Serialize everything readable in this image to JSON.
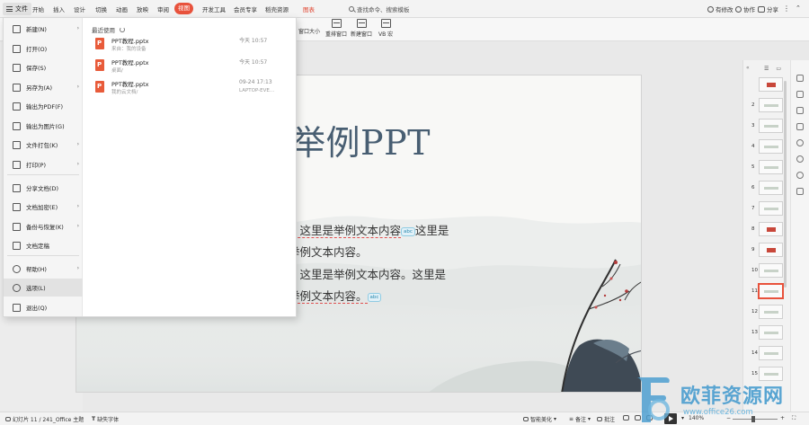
{
  "menubar": {
    "file_label": "文件",
    "tabs": [
      "开始",
      "插入",
      "设计",
      "切换",
      "动画",
      "放映",
      "审阅",
      "视图",
      "开发工具",
      "会员专享",
      "稻壳资源",
      "图表"
    ],
    "active_tab": "视图",
    "search_placeholder": "查找命令、搜索模板",
    "unsaved_label": "有修改",
    "collab_label": "协作",
    "share_label": "分享"
  },
  "ribbon": {
    "items": [
      {
        "label": "重排窗口",
        "icon": "arrange-window-icon"
      },
      {
        "label": "新建窗口",
        "icon": "new-window-icon"
      },
      {
        "label": "VB 宏",
        "icon": "vba-macro-icon"
      }
    ],
    "partial_label": "窗口大小"
  },
  "file_menu": {
    "items": [
      {
        "label": "新建(N)",
        "icon": "new-file-icon",
        "arrow": true
      },
      {
        "label": "打开(O)",
        "icon": "open-folder-icon",
        "arrow": false
      },
      {
        "label": "保存(S)",
        "icon": "save-icon",
        "arrow": false
      },
      {
        "label": "另存为(A)",
        "icon": "save-as-icon",
        "arrow": true
      },
      {
        "label": "输出为PDF(F)",
        "icon": "export-pdf-icon",
        "arrow": false
      },
      {
        "label": "输出为图片(G)",
        "icon": "export-image-icon",
        "arrow": false
      },
      {
        "label": "文件打包(K)",
        "icon": "package-icon",
        "arrow": true
      },
      {
        "label": "打印(P)",
        "icon": "print-icon",
        "arrow": true
      },
      {
        "label": "分享文档(D)",
        "icon": "share-doc-icon",
        "arrow": false
      },
      {
        "label": "文档加密(E)",
        "icon": "encrypt-icon",
        "arrow": true
      },
      {
        "label": "备份与恢复(K)",
        "icon": "backup-icon",
        "arrow": true
      },
      {
        "label": "文档定稿",
        "icon": "finalize-icon",
        "arrow": false
      },
      {
        "label": "帮助(H)",
        "icon": "help-icon",
        "arrow": true
      },
      {
        "label": "选项(L)",
        "icon": "gear-icon",
        "arrow": false
      },
      {
        "label": "退出(Q)",
        "icon": "exit-icon",
        "arrow": false
      }
    ],
    "selected": "选项(L)",
    "recent_header": "最近使用",
    "recent": [
      {
        "name": "PPT教程.pptx",
        "sub": "来自：我的设备",
        "time": "今天 10:57",
        "loc": ""
      },
      {
        "name": "PPT教程.pptx",
        "sub": "桌面/",
        "time": "今天 10:57",
        "loc": ""
      },
      {
        "name": "PPT教程.pptx",
        "sub": "我的云文档/",
        "time": "09-24 17:13",
        "loc": "LAPTOP-EVE..."
      }
    ]
  },
  "slide": {
    "title": "举例PPT",
    "lines": [
      {
        "text": "，这里是举例文本内容",
        "badge": "abc",
        "tail": "这里是"
      },
      {
        "text": "举例文本内容。",
        "badge": "",
        "tail": ""
      },
      {
        "text": "，这里是举例文本内容。这里是",
        "badge": "",
        "tail": ""
      },
      {
        "text": "举例文本内容。",
        "badge": "abc",
        "tail": ""
      }
    ]
  },
  "thumbnails": {
    "numbers": [
      "",
      "2",
      "3",
      "4",
      "5",
      "6",
      "7",
      "8",
      "9",
      "10",
      "11",
      "12",
      "13",
      "14",
      "15"
    ],
    "selected": "11"
  },
  "statusbar": {
    "slide_info": "幻灯片 11 / 24",
    "theme": "1_Office 主题",
    "missing_font": "缺失字体",
    "smart_beautify": "智能美化",
    "notes": "备注",
    "comments": "批注",
    "zoom": "140%"
  },
  "watermark": {
    "title": "欧菲资源网",
    "url": "www.office26.com"
  },
  "colors": {
    "accent": "#e8523c",
    "title": "#485e72",
    "watermark": "#4d9fd0"
  }
}
